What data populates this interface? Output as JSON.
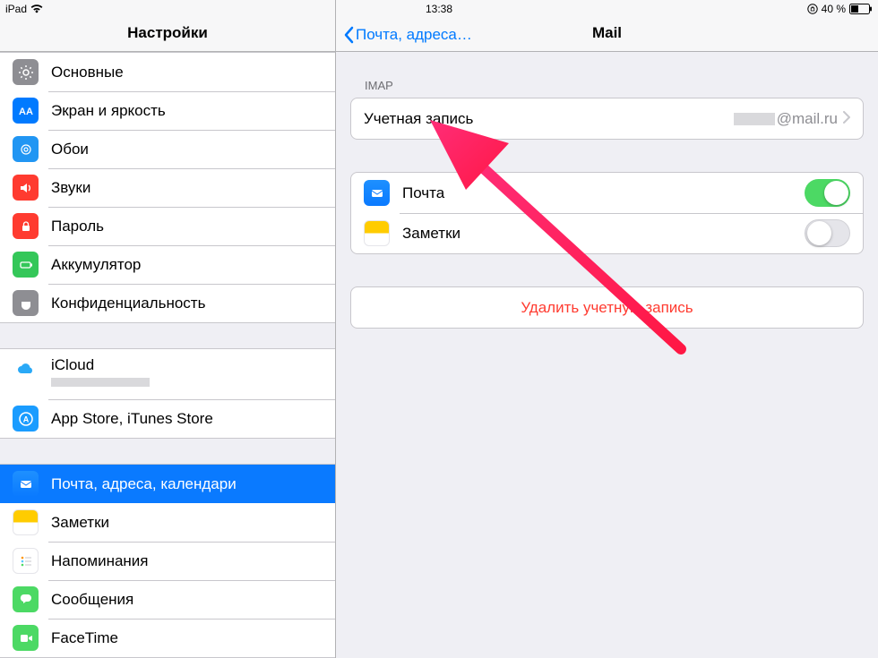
{
  "status": {
    "device": "iPad",
    "time": "13:38",
    "battery_pct": "40 %"
  },
  "sidebar": {
    "title": "Настройки",
    "items": [
      {
        "label": "Основные"
      },
      {
        "label": "Экран и яркость"
      },
      {
        "label": "Обои"
      },
      {
        "label": "Звуки"
      },
      {
        "label": "Пароль"
      },
      {
        "label": "Аккумулятор"
      },
      {
        "label": "Конфиденциальность"
      }
    ],
    "accounts": [
      {
        "label": "iCloud",
        "sub": ""
      },
      {
        "label": "App Store, iTunes Store"
      }
    ],
    "apps": [
      {
        "label": "Почта, адреса, календари",
        "selected": true
      },
      {
        "label": "Заметки"
      },
      {
        "label": "Напоминания"
      },
      {
        "label": "Сообщения"
      },
      {
        "label": "FaceTime"
      }
    ]
  },
  "detail": {
    "back_label": "Почта, адреса…",
    "title": "Mail",
    "section_header": "IMAP",
    "account": {
      "label": "Учетная запись",
      "value_suffix": "@mail.ru"
    },
    "services": [
      {
        "label": "Почта",
        "on": true
      },
      {
        "label": "Заметки",
        "on": false
      }
    ],
    "delete_label": "Удалить учетную запись"
  }
}
